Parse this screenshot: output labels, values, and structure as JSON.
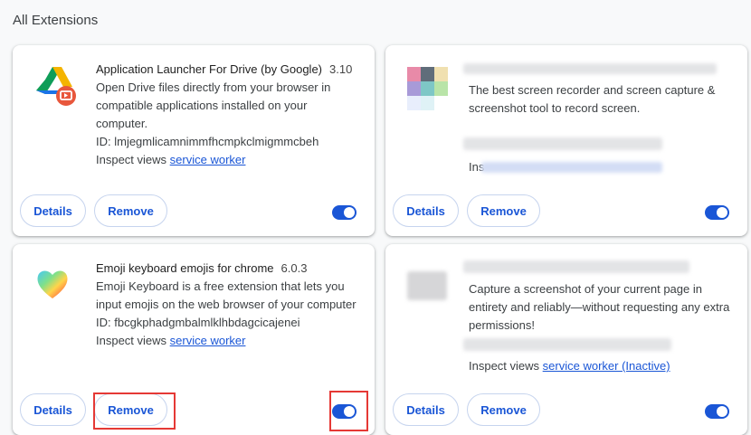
{
  "page": {
    "section_title": "All Extensions"
  },
  "extensions": [
    {
      "name": "Application Launcher For Drive (by Google)",
      "version": "3.10",
      "description": "Open Drive files directly from your browser in compatible applications installed on your computer.",
      "id_label": "ID: lmjegmlicamnimmfhcmpkclmigmmcbeh",
      "inspect_label": "Inspect views",
      "inspect_link": "service worker",
      "details_label": "Details",
      "remove_label": "Remove",
      "enabled": true,
      "icon": "google-drive-launcher-icon"
    },
    {
      "name": "",
      "version": "",
      "description": "The best screen recorder and screen capture & screenshot tool to record screen.",
      "id_label": "",
      "inspect_label": "Ins",
      "inspect_link": "",
      "details_label": "Details",
      "remove_label": "Remove",
      "enabled": true,
      "icon": "blurred-extension-icon"
    },
    {
      "name": "Emoji keyboard emojis for chrome",
      "version": "6.0.3",
      "description": "Emoji Keyboard is a free extension that lets you input emojis on the web browser of your computer",
      "id_label": "ID: fbcgkphadgmbalmlklhbdagcicajenei",
      "inspect_label": "Inspect views",
      "inspect_link": "service worker",
      "details_label": "Details",
      "remove_label": "Remove",
      "enabled": true,
      "icon": "rainbow-heart-icon"
    },
    {
      "name": "",
      "version": "",
      "description": "Capture a screenshot of your current page in entirety and reliably—without requesting any extra permissions!",
      "id_label": "",
      "inspect_label": "Inspect views",
      "inspect_link": "service worker (Inactive)",
      "details_label": "Details",
      "remove_label": "Remove",
      "enabled": true,
      "icon": "blurred-extension-icon"
    }
  ],
  "colors": {
    "accent": "#1a56d6",
    "highlight": "#e53935"
  }
}
